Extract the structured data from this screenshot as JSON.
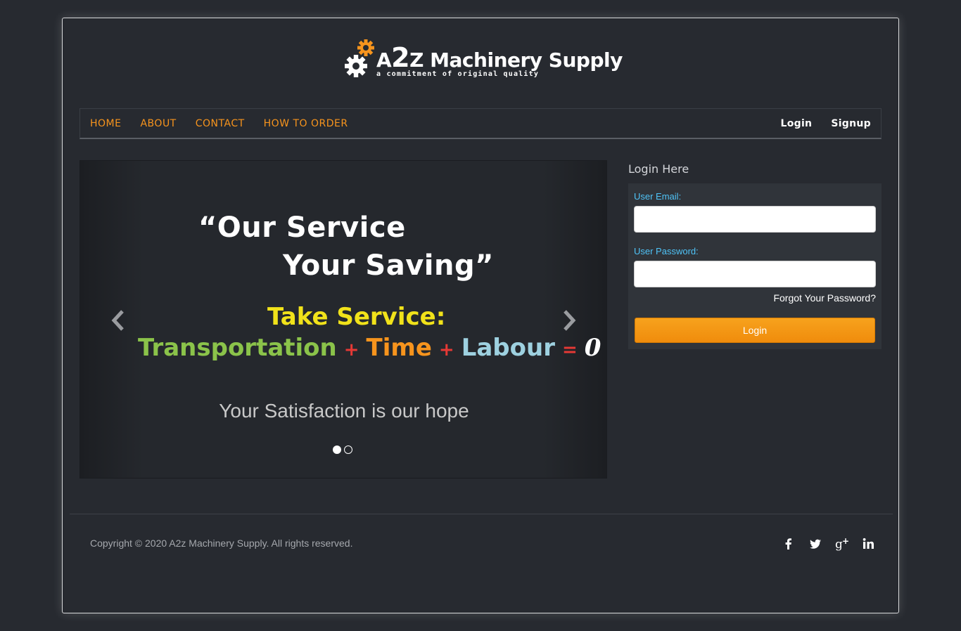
{
  "brand": {
    "name_prefix": "A",
    "name_two": "2",
    "name_rest": "Z Machinery Supply",
    "tagline": "a commitment of original quality"
  },
  "nav": {
    "left": [
      "HOME",
      "ABOUT",
      "CONTACT",
      "HOW TO ORDER"
    ],
    "right": [
      "Login",
      "Signup"
    ]
  },
  "carousel": {
    "quote_line1": "“Our Service",
    "quote_line2": "Your Saving”",
    "take_service": "Take Service:",
    "formula": {
      "term1": "Transportation",
      "plus1": "+",
      "term2": "Time",
      "plus2": "+",
      "term3": "Labour",
      "equals": "=",
      "result": "0"
    },
    "satisfaction": "Your Satisfaction is our hope",
    "slide_count": 2,
    "active_slide": 1
  },
  "login": {
    "title": "Login Here",
    "email_label": "User Email:",
    "email_value": "",
    "password_label": "User Password:",
    "password_value": "",
    "forgot": "Forgot Your Password?",
    "button": "Login"
  },
  "footer": {
    "copyright": "Copyright © 2020 A2z Machinery Supply. All rights reserved.",
    "social_icons": [
      "facebook-icon",
      "twitter-icon",
      "google-plus-icon",
      "linkedin-icon"
    ]
  },
  "colors": {
    "background": "#272a30",
    "accent_orange": "#f7941d",
    "label_blue": "#4fc3f7"
  }
}
